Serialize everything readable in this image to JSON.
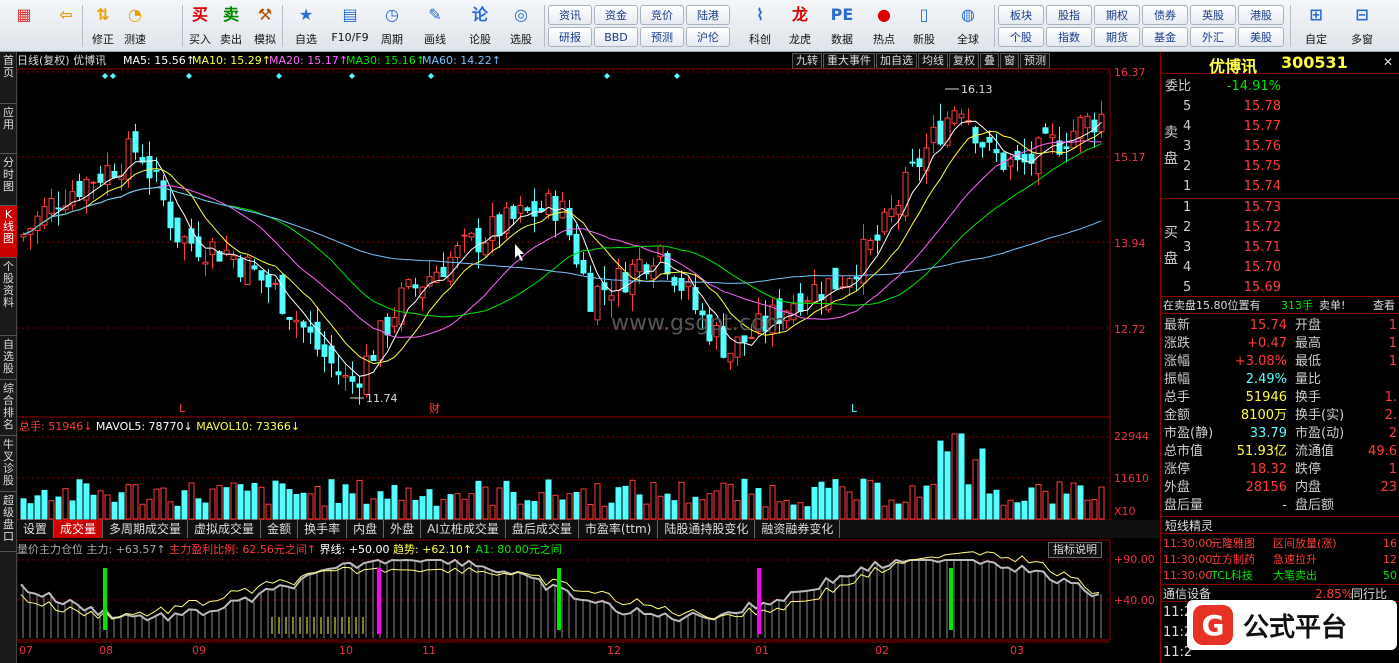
{
  "toolbar": {
    "left_buttons": [
      {
        "label": "",
        "icon": "grid-icon"
      },
      {
        "label": "",
        "icon": "back-arrow-icon"
      },
      {
        "label": "修正",
        "icon": "up-down-arrow-icon"
      },
      {
        "label": "测速",
        "icon": "speed-icon"
      },
      {
        "label": "买入",
        "icon": "buy-icon"
      },
      {
        "label": "卖出",
        "icon": "sell-icon"
      },
      {
        "label": "模拟",
        "icon": "hammer-icon"
      },
      {
        "label": "自选",
        "icon": "star-box-icon"
      },
      {
        "label": "F10/F9",
        "icon": "f10-icon"
      },
      {
        "label": "周期",
        "icon": "clock-icon"
      },
      {
        "label": "画线",
        "icon": "pencil-icon"
      },
      {
        "label": "论股",
        "icon": "discuss-icon"
      },
      {
        "label": "选股",
        "icon": "magnify-chart-icon"
      }
    ],
    "grid1": [
      [
        "资讯",
        "资金",
        "竞价",
        "陆港"
      ],
      [
        "研报",
        "BBD",
        "预测",
        "沪伦"
      ]
    ],
    "mid_buttons": [
      {
        "label": "科创",
        "icon": "kechuang-icon"
      },
      {
        "label": "龙虎",
        "icon": "dragon-icon"
      },
      {
        "label": "数据",
        "icon": "pe-icon"
      },
      {
        "label": "热点",
        "icon": "hot-icon"
      },
      {
        "label": "新股",
        "icon": "newstock-icon"
      },
      {
        "label": "全球",
        "icon": "globe-icon"
      }
    ],
    "grid2": [
      [
        "板块",
        "股指",
        "期权",
        "债券",
        "英股",
        "港股"
      ],
      [
        "个股",
        "指数",
        "期货",
        "基金",
        "外汇",
        "美股"
      ]
    ],
    "right_buttons": [
      {
        "label": "自定",
        "icon": "custom-icon"
      },
      {
        "label": "多窗",
        "icon": "multiwindow-icon"
      }
    ]
  },
  "vtabs": [
    "首页",
    "应用",
    "分时图",
    "K线图",
    "个股资料",
    "自选股",
    "综合排名",
    "牛叉诊股",
    "超级盘口"
  ],
  "vtabs_active": 3,
  "kline_header": {
    "name": "日线(复权)  优博讯",
    "ma5": "MA5: 15.56↑",
    "ma10": "MA10: 15.29↑",
    "ma20": "MA20: 15.17↑",
    "ma30": "MA30: 15.16↑",
    "ma60": "MA60: 14.22↑",
    "buttons": [
      "九转",
      "重大事件",
      "加自选",
      "均线",
      "复权",
      "叠",
      "窗",
      "预测"
    ]
  },
  "price_axis": [
    "16.37",
    "15.17",
    "13.94",
    "12.72"
  ],
  "high_label": "16.13",
  "low_label": "11.74",
  "markers": [
    "L",
    "财",
    "L"
  ],
  "watermark": "www.gsgpt.com",
  "volume_header": {
    "total": "总手: 51946↓",
    "mavol5": "MAVOL5: 78770↓",
    "mavol10": "MAVOL10: 73366↓"
  },
  "volume_axis": [
    "22944",
    "11610",
    "X10"
  ],
  "bottom_tabs": [
    "设置",
    "成交量",
    "多周期成交量",
    "虚拟成交量",
    "金额",
    "换手率",
    "内盘",
    "外盘",
    "AI立桩成交量",
    "盘后成交量",
    "市盈率(ttm)",
    "陆股通持股变化",
    "融资融券变化"
  ],
  "bottom_tabs_active": 1,
  "indicator_header": {
    "name": "量价主力仓位",
    "main": "主力: +63.57↑",
    "ratio": "主力盈利比例: 62.56元之间↑",
    "line": "界线: +50.00",
    "trend": "趋势: +62.10↑",
    "a1": "A1: 80.00元之间"
  },
  "indicator_button": "指标说明",
  "indicator_axis": [
    "+90.00",
    "+40.00"
  ],
  "months": [
    "07",
    "08",
    "09",
    "10",
    "11",
    "12",
    "01",
    "02",
    "03"
  ],
  "right_panel": {
    "stock_title": "优博讯",
    "stock_code": "300531",
    "weibi_label": "委比",
    "weibi_value": "-14.91%",
    "sell_label": "卖盘",
    "buy_label": "买盘",
    "asks": [
      [
        "5",
        "15.78"
      ],
      [
        "4",
        "15.77"
      ],
      [
        "3",
        "15.76"
      ],
      [
        "2",
        "15.75"
      ],
      [
        "1",
        "15.74"
      ]
    ],
    "bids": [
      [
        "1",
        "15.73"
      ],
      [
        "2",
        "15.72"
      ],
      [
        "3",
        "15.71"
      ],
      [
        "4",
        "15.70"
      ],
      [
        "5",
        "15.69"
      ]
    ],
    "notice": "在卖盘15.80位置有",
    "notice_qty": "313手",
    "notice_tail": "卖单!",
    "notice_more": "查看",
    "quote_rows": [
      {
        "l1": "最新",
        "v1": "15.74",
        "l2": "开盘",
        "v2": "1"
      },
      {
        "l1": "涨跌",
        "v1": "+0.47",
        "l2": "最高",
        "v2": "1"
      },
      {
        "l1": "涨幅",
        "v1": "+3.08%",
        "l2": "最低",
        "v2": "1"
      },
      {
        "l1": "振幅",
        "v1": "2.49%",
        "l2": "量比",
        "v2": ""
      },
      {
        "l1": "总手",
        "v1": "51946",
        "l2": "换手",
        "v2": "1."
      },
      {
        "l1": "金额",
        "v1": "8100万",
        "l2": "换手(实)",
        "v2": "2."
      },
      {
        "l1": "市盈(静)",
        "v1": "33.79",
        "l2": "市盈(动)",
        "v2": "2"
      },
      {
        "l1": "总市值",
        "v1": "51.93亿",
        "l2": "流通值",
        "v2": "49.6"
      },
      {
        "l1": "涨停",
        "v1": "18.32",
        "l2": "跌停",
        "v2": "1"
      },
      {
        "l1": "外盘",
        "v1": "28156",
        "l2": "内盘",
        "v2": "23"
      },
      {
        "l1": "盘后量",
        "v1": "-",
        "l2": "盘后额",
        "v2": ""
      }
    ],
    "jingling_title": "短线精灵",
    "jingling": [
      {
        "time": "11:30:00",
        "name": "元隆雅图",
        "event": "区间放量(涨)",
        "val": "16"
      },
      {
        "time": "11:30:00",
        "name": "立方制药",
        "event": "急速拉升",
        "val": "12"
      },
      {
        "time": "11:30:00",
        "name": "TCL科技",
        "event": "大笔卖出",
        "val": "50"
      }
    ],
    "device_label": "通信设备",
    "device_pct": "2.85%",
    "peer_label": "同行比",
    "time_rows": [
      "11:2",
      "11:2",
      "11:2"
    ],
    "logo_text": "公式平台"
  }
}
